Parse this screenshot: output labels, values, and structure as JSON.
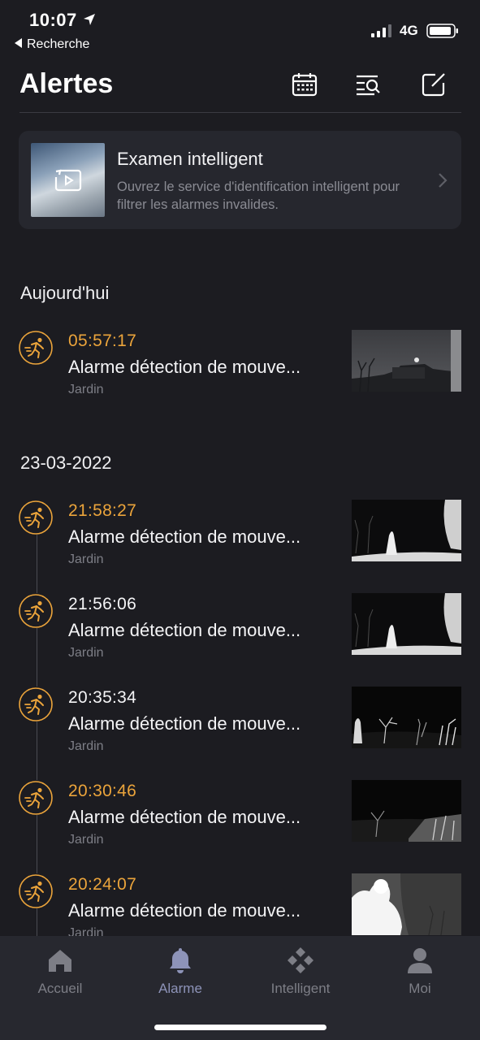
{
  "status_bar": {
    "time": "10:07",
    "back_label": "Recherche",
    "network": "4G"
  },
  "header": {
    "title": "Alertes",
    "icons": [
      "calendar-icon",
      "search-list-icon",
      "edit-icon"
    ]
  },
  "smart_card": {
    "title": "Examen intelligent",
    "description": "Ouvrez le service d'identification intelligent pour filtrer les alarmes invalides."
  },
  "sections": [
    {
      "title": "Aujourd'hui",
      "alerts": [
        {
          "time": "05:57:17",
          "highlight": true,
          "title": "Alarme détection de mouve...",
          "location": "Jardin"
        }
      ]
    },
    {
      "title": "23-03-2022",
      "alerts": [
        {
          "time": "21:58:27",
          "highlight": true,
          "title": "Alarme détection de mouve...",
          "location": "Jardin"
        },
        {
          "time": "21:56:06",
          "highlight": false,
          "title": "Alarme détection de mouve...",
          "location": "Jardin"
        },
        {
          "time": "20:35:34",
          "highlight": false,
          "title": "Alarme détection de mouve...",
          "location": "Jardin"
        },
        {
          "time": "20:30:46",
          "highlight": true,
          "title": "Alarme détection de mouve...",
          "location": "Jardin"
        },
        {
          "time": "20:24:07",
          "highlight": true,
          "title": "Alarme détection de mouve...",
          "location": "Jardin"
        }
      ]
    }
  ],
  "tabs": [
    {
      "label": "Accueil",
      "icon": "home-icon",
      "active": false
    },
    {
      "label": "Alarme",
      "icon": "bell-icon",
      "active": true
    },
    {
      "label": "Intelligent",
      "icon": "diamond-grid-icon",
      "active": false
    },
    {
      "label": "Moi",
      "icon": "user-icon",
      "active": false
    }
  ],
  "colors": {
    "accent": "#eba43b",
    "background": "#1c1c21",
    "active_tab": "#8d93b8"
  }
}
